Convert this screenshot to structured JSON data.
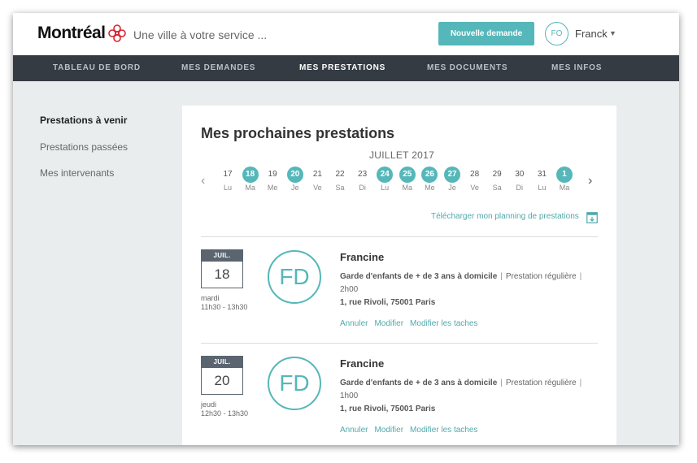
{
  "header": {
    "logo_text": "Montréal",
    "tagline": "Une ville à votre service ...",
    "new_request_label": "Nouvelle demande",
    "user_initials": "FO",
    "user_name": "Franck"
  },
  "nav": {
    "items": [
      {
        "label": "TABLEAU DE BORD",
        "active": false
      },
      {
        "label": "MES DEMANDES",
        "active": false
      },
      {
        "label": "MES PRESTATIONS",
        "active": true
      },
      {
        "label": "MES DOCUMENTS",
        "active": false
      },
      {
        "label": "MES INFOS",
        "active": false
      }
    ]
  },
  "sidebar": {
    "items": [
      {
        "label": "Prestations à venir",
        "active": true
      },
      {
        "label": "Prestations passées",
        "active": false
      },
      {
        "label": "Mes intervenants",
        "active": false
      }
    ]
  },
  "main": {
    "title": "Mes prochaines prestations",
    "calendar": {
      "month": "JUILLET 2017",
      "days": [
        {
          "num": "17",
          "label": "Lu",
          "highlight": false
        },
        {
          "num": "18",
          "label": "Ma",
          "highlight": true
        },
        {
          "num": "19",
          "label": "Me",
          "highlight": false
        },
        {
          "num": "20",
          "label": "Je",
          "highlight": true
        },
        {
          "num": "21",
          "label": "Ve",
          "highlight": false
        },
        {
          "num": "22",
          "label": "Sa",
          "highlight": false
        },
        {
          "num": "23",
          "label": "Di",
          "highlight": false
        },
        {
          "num": "24",
          "label": "Lu",
          "highlight": true
        },
        {
          "num": "25",
          "label": "Ma",
          "highlight": true
        },
        {
          "num": "26",
          "label": "Me",
          "highlight": true
        },
        {
          "num": "27",
          "label": "Je",
          "highlight": true
        },
        {
          "num": "28",
          "label": "Ve",
          "highlight": false
        },
        {
          "num": "29",
          "label": "Sa",
          "highlight": false
        },
        {
          "num": "30",
          "label": "Di",
          "highlight": false
        },
        {
          "num": "31",
          "label": "Lu",
          "highlight": false
        },
        {
          "num": "1",
          "label": "Ma",
          "highlight": true
        }
      ]
    },
    "download_label": "Télécharger mon planning de prestations",
    "appointments": [
      {
        "month": "JUIL.",
        "day": "18",
        "weekday": "mardi",
        "time": "11h30 - 13h30",
        "initials": "FD",
        "name": "Francine",
        "service": "Garde d'enfants de + de 3 ans à domicile",
        "type": "Prestation régulière",
        "duration": "2h00",
        "address": "1, rue Rivoli, 75001 Paris",
        "actions": {
          "cancel": "Annuler",
          "edit": "Modifier",
          "edit_tasks": "Modifier les taches"
        }
      },
      {
        "month": "JUIL.",
        "day": "20",
        "weekday": "jeudi",
        "time": "12h30 - 13h30",
        "initials": "FD",
        "name": "Francine",
        "service": "Garde d'enfants de + de 3 ans à domicile",
        "type": "Prestation régulière",
        "duration": "1h00",
        "address": "1, rue Rivoli, 75001 Paris",
        "actions": {
          "cancel": "Annuler",
          "edit": "Modifier",
          "edit_tasks": "Modifier les taches"
        }
      }
    ]
  },
  "colors": {
    "accent": "#55b7b9",
    "nav_bg": "#343b43",
    "page_bg": "#e9edee"
  }
}
